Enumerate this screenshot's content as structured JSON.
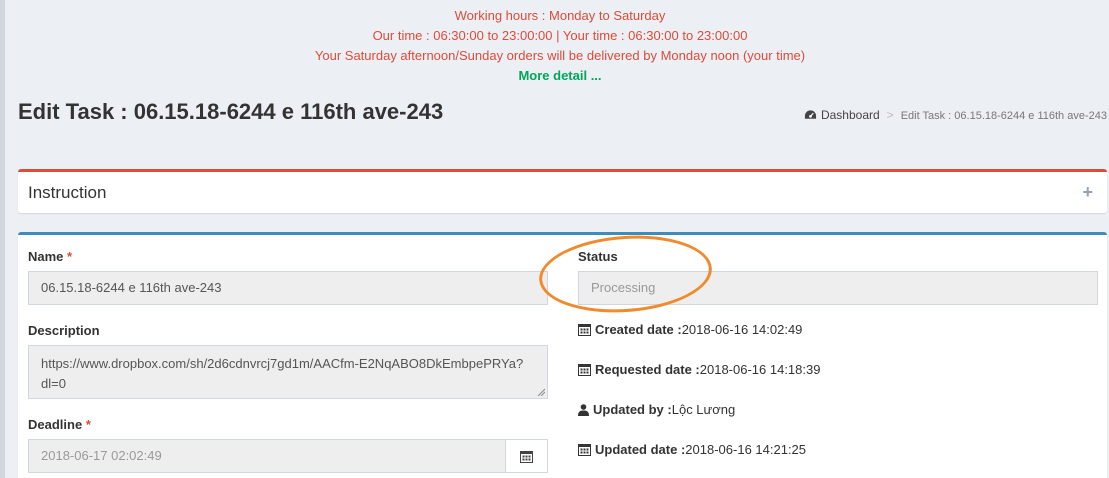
{
  "notice": {
    "line1": "Working hours : Monday to Saturday",
    "line2": "Our time : 06:30:00 to 23:00:00 | Your time : 06:30:00 to 23:00:00",
    "line3": "Your Saturday afternoon/Sunday orders will be delivered by Monday noon (your time)",
    "more_link": "More detail ..."
  },
  "header": {
    "title": "Edit Task : 06.15.18-6244 e 116th ave-243",
    "breadcrumb": {
      "home": "Dashboard",
      "separator": ">",
      "current": "Edit Task : 06.15.18-6244 e 116th ave-243"
    }
  },
  "instruction": {
    "title": "Instruction",
    "toggle": "+"
  },
  "form": {
    "name": {
      "label": "Name",
      "required": "*",
      "value": "06.15.18-6244 e 116th ave-243"
    },
    "description": {
      "label": "Description",
      "line1": "https://www.dropbox.com/sh/2d6cdnvrcj7gd1m/AACfm-E2NqABO8DkEmbpePRYa?",
      "line2": "dl=0"
    },
    "deadline": {
      "label": "Deadline",
      "required": "*",
      "value": "2018-06-17 02:02:49"
    },
    "status": {
      "label": "Status",
      "value": "Processing"
    }
  },
  "info": {
    "created": {
      "label": "Created date :",
      "value": "2018-06-16 14:02:49"
    },
    "requested": {
      "label": "Requested date :",
      "value": "2018-06-16 14:18:39"
    },
    "updated_by": {
      "label": "Updated by :",
      "value": "Lộc Lương"
    },
    "updated": {
      "label": "Updated date :",
      "value": "2018-06-16 14:21:25"
    }
  },
  "colors": {
    "notice_red": "#dd4b39",
    "notice_green": "#00a65a",
    "instruction_border": "#dd4b39",
    "main_border": "#3c8dbc",
    "annotation_circle": "#f08a2c"
  }
}
